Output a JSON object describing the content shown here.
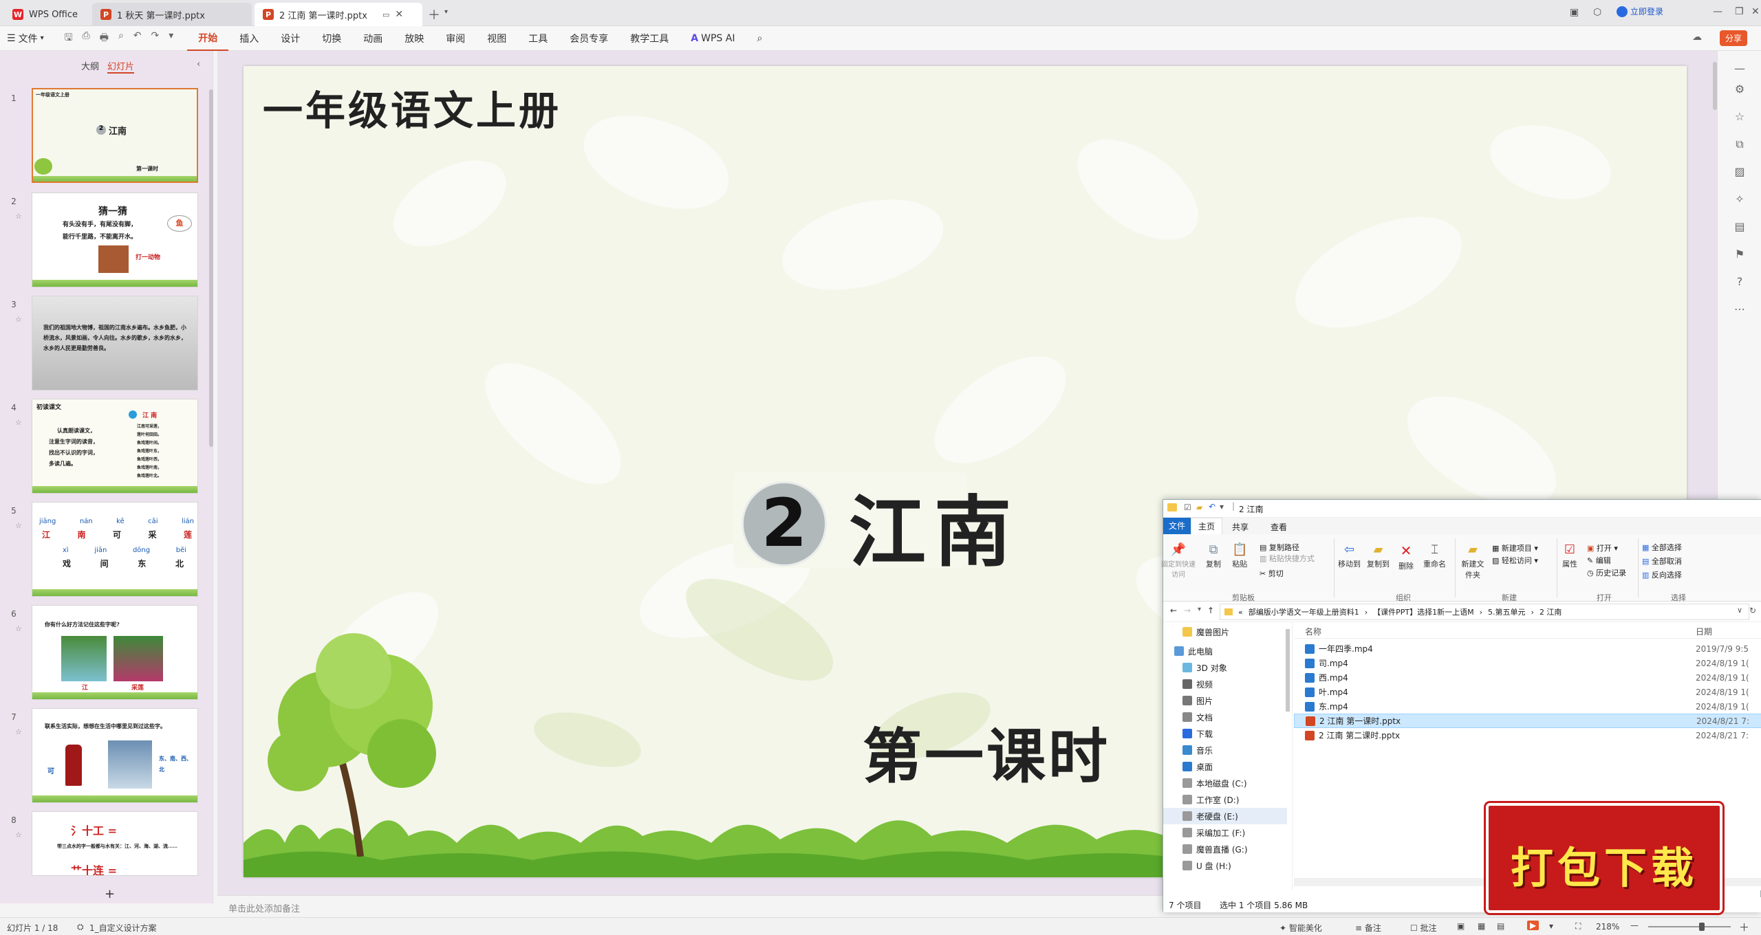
{
  "titlebar": {
    "tabs": [
      {
        "label": "WPS Office",
        "icon": "wps-logo-icon"
      },
      {
        "label": "1 秋天 第一课时.pptx",
        "icon": "ppt-file-icon"
      },
      {
        "label": "2 江南 第一课时.pptx",
        "icon": "ppt-file-icon",
        "active": true
      }
    ],
    "login_label": "立即登录"
  },
  "menubar": {
    "file_label": "文件",
    "items": [
      "开始",
      "插入",
      "设计",
      "切换",
      "动画",
      "放映",
      "审阅",
      "视图",
      "工具",
      "会员专享",
      "教学工具"
    ],
    "ai_label": "WPS AI",
    "share_label": "分享"
  },
  "leftpanel": {
    "tabs": [
      "大纲",
      "幻灯片"
    ],
    "slide_numbers": [
      "1",
      "2",
      "3",
      "4",
      "5",
      "6",
      "7",
      "8"
    ],
    "thumb1": {
      "header": "一年级语文上册",
      "title": "江南",
      "num": "2",
      "sub": "第一课时"
    },
    "thumb2": {
      "title": "猜一猜",
      "line1": "有头没有手，有尾没有脚，",
      "line2": "能行千里路，不能离开水。",
      "answer_label": "鱼",
      "hint": "打一动物"
    },
    "thumb3": {
      "text": "我们的祖国地大物博，祖国的江南水乡遍布。水乡鱼肥，小桥流水，风景如画，令人向往。水乡的歌乡，水乡的水乡，水乡的人民更是勤劳善良。"
    },
    "thumb4": {
      "header": "初读课文",
      "steps": [
        "认真朗读课文，",
        "注意生字词的读音，",
        "找出不认识的字词，",
        "多读几遍。"
      ],
      "title": "江 南",
      "poem": [
        "江南可采莲，",
        "莲叶何田田。",
        "鱼戏莲叶间。",
        "鱼戏莲叶东，",
        "鱼戏莲叶西，",
        "鱼戏莲叶南，",
        "鱼戏莲叶北。"
      ]
    },
    "thumb5": {
      "pinyin1": [
        "jiāng",
        "nán",
        "kě",
        "cǎi",
        "lián"
      ],
      "chars1": [
        "江",
        "南",
        "可",
        "采",
        "莲"
      ],
      "pinyin2": [
        "xì",
        "jiān",
        "dōng",
        "běi"
      ],
      "chars2": [
        "戏",
        "间",
        "东",
        "北"
      ]
    },
    "thumb6": {
      "question": "你有什么好方法记住这些字呢?",
      "label1": "江",
      "label2": "采莲"
    },
    "thumb7": {
      "question": "联系生活实际，想想在生活中哪里见到过这些字。",
      "label1": "可",
      "label2": "东、南、西、北"
    },
    "thumb8": {
      "formula1": "氵十工 =",
      "text": "带三点水的字一般都与水有关：江、河、海、湖、流……",
      "formula2": "艹十连 ="
    },
    "add_label": "+"
  },
  "slide": {
    "header": "一年级语文上册",
    "lesson_num": "2",
    "title": "江南",
    "subtitle": "第一课时"
  },
  "notes_placeholder": "单击此处添加备注",
  "statusbar": {
    "slide_count": "幻灯片 1 / 18",
    "theme": "1_自定义设计方案",
    "beautify": "智能美化",
    "notes": "备注",
    "comments": "批注",
    "zoom": "218%"
  },
  "explorer": {
    "title": "2 江南",
    "tabs": [
      "文件",
      "主页",
      "共享",
      "查看"
    ],
    "ribbon": {
      "clipboard": {
        "group": "剪贴板",
        "pin": "固定到快速访问",
        "copy": "复制",
        "paste": "粘贴",
        "copy_path": "复制路径",
        "paste_shortcut": "粘贴快捷方式",
        "cut": "剪切"
      },
      "organize": {
        "group": "组织",
        "move_to": "移动到",
        "copy_to": "复制到",
        "delete": "删除",
        "rename": "重命名"
      },
      "new": {
        "group": "新建",
        "new_folder": "新建文件夹",
        "new_item": "新建项目",
        "easy_access": "轻松访问"
      },
      "open": {
        "group": "打开",
        "properties": "属性",
        "open": "打开",
        "edit": "编辑",
        "history": "历史记录"
      },
      "select": {
        "group": "选择",
        "select_all": "全部选择",
        "select_none": "全部取消",
        "invert": "反向选择"
      }
    },
    "breadcrumb": [
      "部编版小学语文一年级上册资料1",
      "【课件PPT】选择1新一上语M",
      "5.第五单元",
      "2 江南"
    ],
    "nav": [
      "魔兽图片",
      "此电脑",
      "3D 对象",
      "视频",
      "图片",
      "文档",
      "下载",
      "音乐",
      "桌面",
      "本地磁盘 (C:)",
      "工作室 (D:)",
      "老硬盘 (E:)",
      "采编加工 (F:)",
      "魔兽直播 (G:)",
      "U 盘 (H:)"
    ],
    "columns": {
      "name": "名称",
      "date": "日期"
    },
    "files": [
      {
        "name": "一年四季.mp4",
        "date": "2019/7/9 9:5",
        "type": "video"
      },
      {
        "name": "司.mp4",
        "date": "2024/8/19 1(",
        "type": "video"
      },
      {
        "name": "西.mp4",
        "date": "2024/8/19 1(",
        "type": "video"
      },
      {
        "name": "叶.mp4",
        "date": "2024/8/19 1(",
        "type": "video"
      },
      {
        "name": "东.mp4",
        "date": "2024/8/19 1(",
        "type": "video"
      },
      {
        "name": "2 江南 第一课时.pptx",
        "date": "2024/8/21 7:",
        "type": "ppt",
        "selected": true
      },
      {
        "name": "2 江南 第二课时.pptx",
        "date": "2024/8/21 7:",
        "type": "ppt"
      }
    ],
    "status": {
      "count": "7 个项目",
      "selected": "选中 1 个项目  5.86 MB"
    }
  },
  "banner": {
    "label": "打包下载"
  },
  "colors": {
    "accent": "#d24625",
    "banner": "#c71b1b",
    "selection": "#cce8ff"
  }
}
